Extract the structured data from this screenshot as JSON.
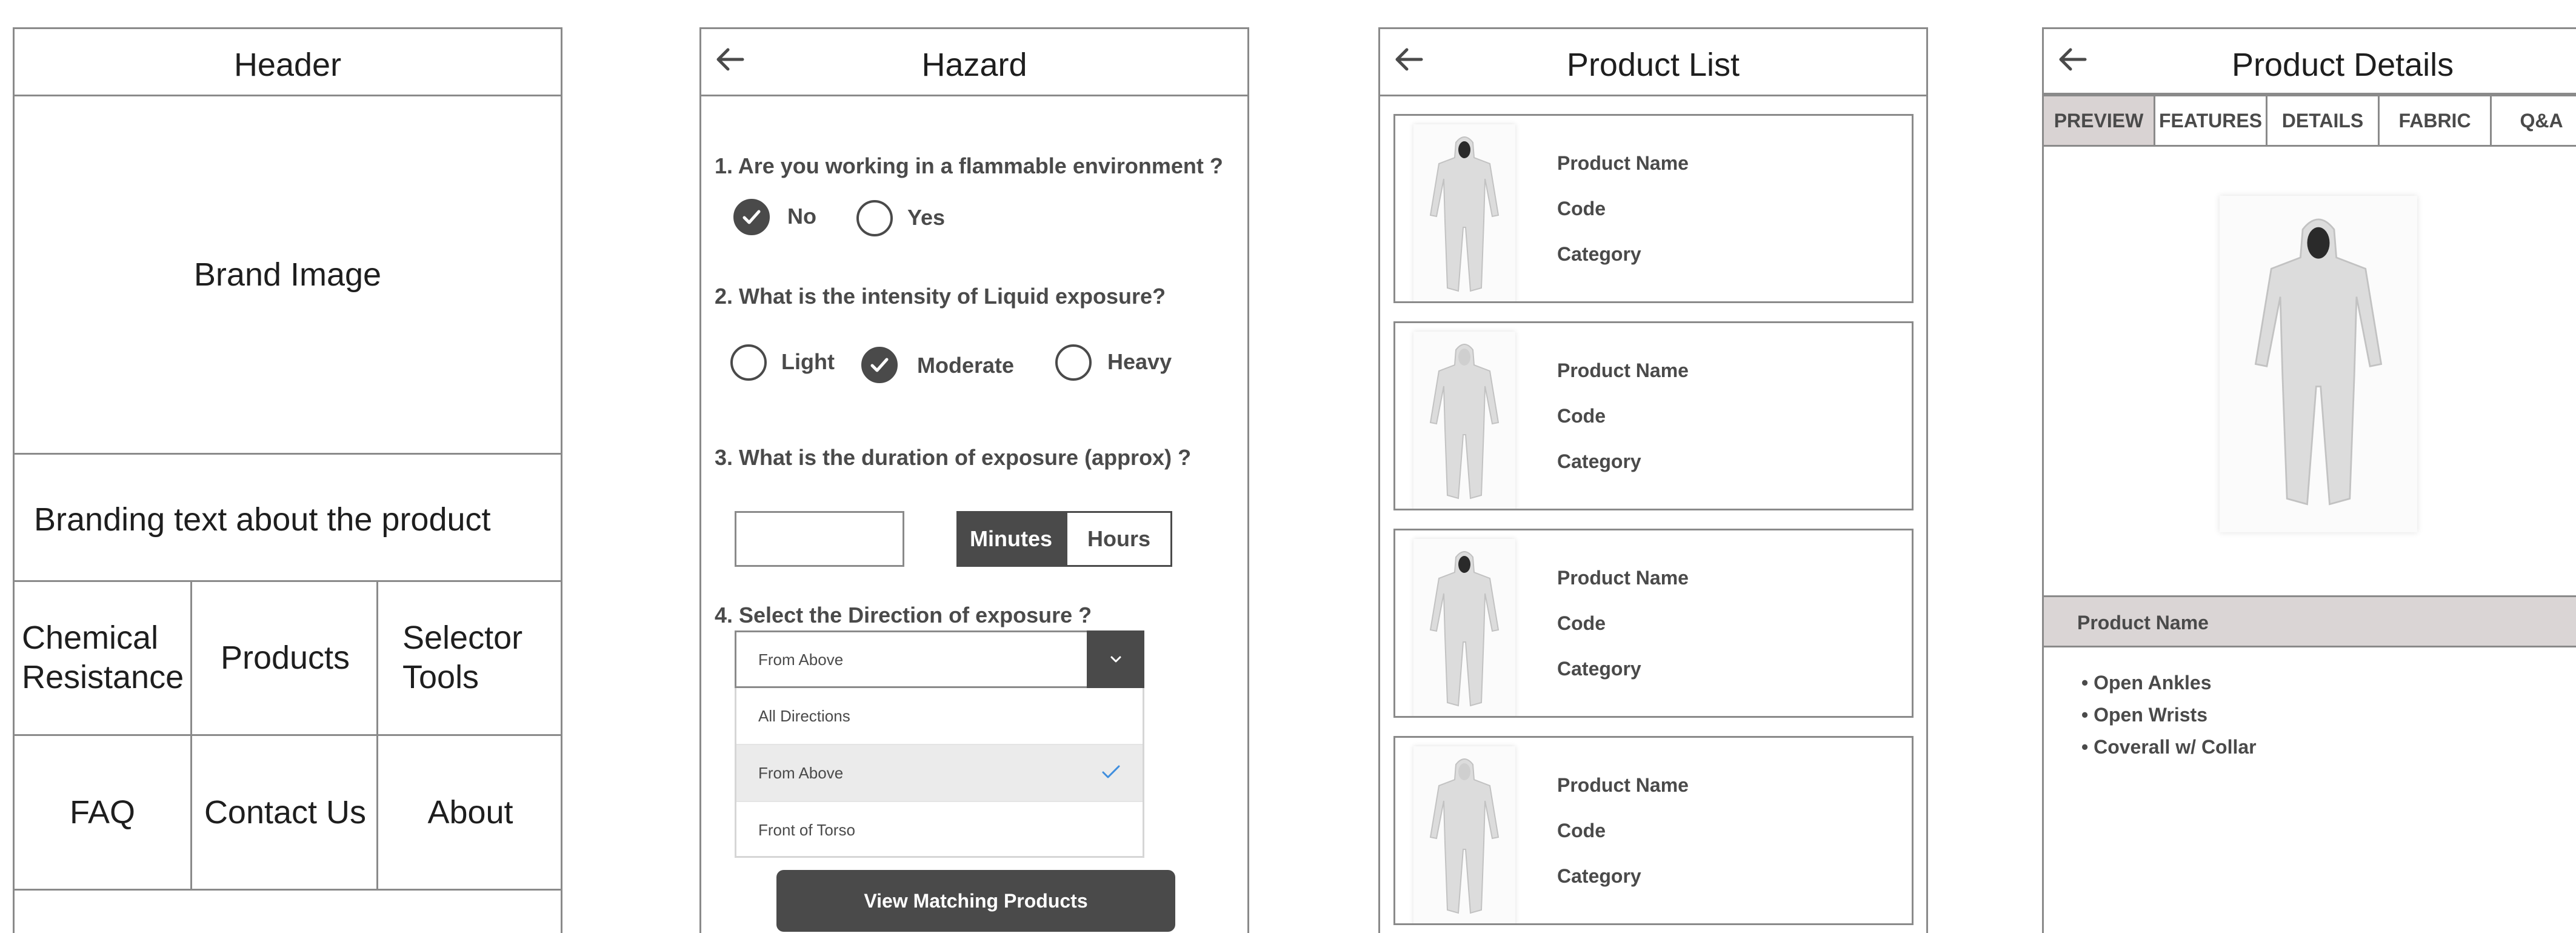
{
  "home": {
    "header": "Header",
    "brand_image": "Brand Image",
    "branding_text": "Branding text about the product",
    "grid": [
      "Chemical Resistance",
      "Products",
      "Selector Tools",
      "FAQ",
      "Contact Us",
      "About"
    ]
  },
  "hazard": {
    "title": "Hazard",
    "q1": "1. Are you working in a flammable environment ?",
    "q1_options": [
      "No",
      "Yes"
    ],
    "q1_selected": "No",
    "q2": "2. What is the intensity of Liquid exposure?",
    "q2_options": [
      "Light",
      "Moderate",
      "Heavy"
    ],
    "q2_selected": "Moderate",
    "q3": "3. What is the duration of exposure (approx) ?",
    "duration_value": "",
    "units": [
      "Minutes",
      "Hours"
    ],
    "unit_selected": "Minutes",
    "q4": "4. Select the Direction of exposure ?",
    "direction_selected": "From Above",
    "direction_options": [
      "All Directions",
      "From Above",
      "Front of Torso"
    ],
    "cta": "View Matching Products"
  },
  "product_list": {
    "title": "Product List",
    "items": [
      {
        "name": "Product Name",
        "code": "Code",
        "category": "Category"
      },
      {
        "name": "Product Name",
        "code": "Code",
        "category": "Category"
      },
      {
        "name": "Product Name",
        "code": "Code",
        "category": "Category"
      },
      {
        "name": "Product Name",
        "code": "Code",
        "category": "Category"
      }
    ]
  },
  "product_details": {
    "title": "Product Details",
    "tabs": [
      "PREVIEW",
      "FEATURES",
      "DETAILS",
      "FABRIC",
      "Q&A"
    ],
    "active_tab": "PREVIEW",
    "product_name": "Product Name",
    "features": [
      "Open Ankles",
      "Open Wrists",
      "Coverall w/ Collar"
    ]
  },
  "colors": {
    "border": "#8a8a8a",
    "dark": "#4a4a4a",
    "active_tab_bg": "#d9d3d3",
    "name_bar_bg": "#dad5d5",
    "check_blue": "#3f8ede"
  },
  "icons": {
    "back": "back-arrow-icon",
    "check": "checkmark-icon",
    "dropdown": "chevron-down-icon"
  }
}
